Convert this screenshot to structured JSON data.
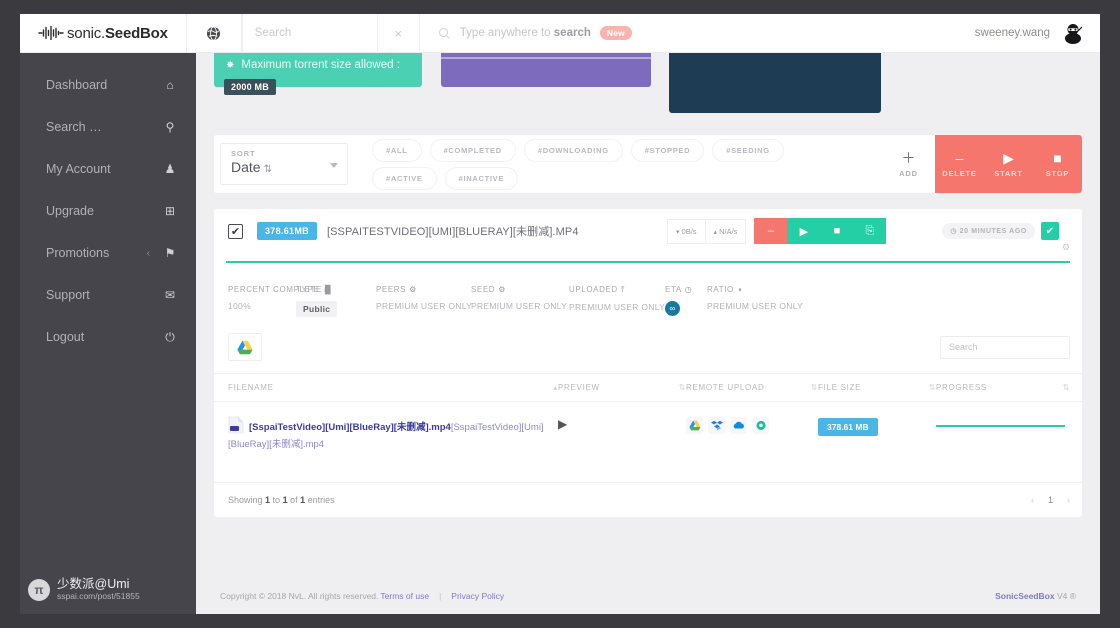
{
  "header": {
    "brand_thin": "sonic.",
    "brand_bold": "SeedBox",
    "globe_icon": "globe-icon",
    "search_placeholder": "Search",
    "search_value": "",
    "clear_icon": "×",
    "omni_icon": "search-icon",
    "omni_text_pre": "Type anywhere to ",
    "omni_text_bold": "search",
    "omni_badge": "New",
    "user_name": "sweeney.wang",
    "avatar_icon": "ninja-avatar"
  },
  "sidebar": {
    "items": [
      {
        "label": "Dashboard",
        "icon": "⌂",
        "name": "home-icon",
        "caret": ""
      },
      {
        "label": "Search …",
        "icon": "⚲",
        "name": "search-icon",
        "caret": ""
      },
      {
        "label": "My Account",
        "icon": "♟",
        "name": "user-icon",
        "caret": ""
      },
      {
        "label": "Upgrade",
        "icon": "⊞",
        "name": "plus-box-icon",
        "caret": ""
      },
      {
        "label": "Promotions",
        "icon": "⚑",
        "name": "tag-icon",
        "caret": "‹"
      },
      {
        "label": "Support",
        "icon": "✉",
        "name": "mail-icon",
        "caret": ""
      },
      {
        "label": "Logout",
        "icon": "⏻",
        "name": "power-icon",
        "caret": ""
      }
    ],
    "watermark": {
      "mark": "π",
      "title": "少数派@Umi",
      "url": "sspai.com/post/51855"
    }
  },
  "promos": {
    "a": {
      "star": "✸",
      "title": "Maximum torrent size allowed :",
      "badge": "2000 MB",
      "color": "#4bd0b4"
    },
    "b": {
      "color": "#7d6bbd"
    },
    "c": {
      "color": "#1e3d55"
    }
  },
  "sortbar": {
    "sort_caption": "SORT",
    "sort_value": "Date",
    "sort_arrows": "⇅",
    "tags": [
      "#ALL",
      "#COMPLETED",
      "#DOWNLOADING",
      "#STOPPED",
      "#SEEDING",
      "#ACTIVE",
      "#INACTIVE"
    ],
    "actions": [
      {
        "glyph": "＋",
        "label": "ADD",
        "style": "add"
      },
      {
        "glyph": "–",
        "label": "DELETE",
        "style": "red"
      },
      {
        "glyph": "▶",
        "label": "START",
        "style": "red"
      },
      {
        "glyph": "■",
        "label": "STOP",
        "style": "red"
      }
    ],
    "accent_red": "#f4766c"
  },
  "torrent": {
    "checkbox_icon": "✔",
    "size_badge": "378.61MB",
    "name": "[SspaiTestVideo][Umi][BlueRay][未删减].mp4",
    "down_arrow": "▾",
    "down_speed": "0B/s",
    "up_arrow": "▴",
    "up_speed": "N/A/s",
    "buttons": [
      {
        "glyph": "–",
        "name": "remove-torrent-button",
        "style": "minus"
      },
      {
        "glyph": "▶",
        "name": "start-torrent-button",
        "style": "play"
      },
      {
        "glyph": "■",
        "name": "stop-torrent-button",
        "style": "stop"
      },
      {
        "glyph": "⎘",
        "name": "torrent-file-button",
        "style": "file"
      }
    ],
    "ago": "◷ 20 MINUTES AGO",
    "ok_icon": "✔",
    "gear_icon": "⚙",
    "progress_percent": 100,
    "stats": [
      {
        "head": "PERCENT COMPLETE",
        "head_icon": "█",
        "value": "100%",
        "kind": "text",
        "w": "s1"
      },
      {
        "head": "TYPE",
        "head_icon": "♁",
        "value": "Public",
        "kind": "chip",
        "w": "s2"
      },
      {
        "head": "PEERS",
        "head_icon": "⚙",
        "value": "PREMIUM USER ONLY",
        "kind": "text",
        "w": "s3"
      },
      {
        "head": "SEED",
        "head_icon": "⚙",
        "value": "PREMIUM USER ONLY",
        "kind": "text",
        "w": "s4"
      },
      {
        "head": "UPLOADED",
        "head_icon": "⤒",
        "value": "PREMIUM USER ONLY",
        "kind": "text",
        "w": "s5"
      },
      {
        "head": "ETA",
        "head_icon": "◷",
        "value": "∞",
        "kind": "dot",
        "w": "s6"
      },
      {
        "head": "RATIO",
        "head_icon": "◑",
        "value": "PREMIUM USER ONLY",
        "kind": "text",
        "w": "s7"
      }
    ]
  },
  "filetable": {
    "drive_icon": "google-drive-icon",
    "search_placeholder": "Search",
    "search_value": "",
    "columns": [
      {
        "label": "FILENAME",
        "sort": "▴"
      },
      {
        "label": "PREVIEW",
        "sort": "⇅"
      },
      {
        "label": "REMOTE UPLOAD",
        "sort": "⇅"
      },
      {
        "label": "FILE SIZE",
        "sort": "⇅"
      },
      {
        "label": "PROGRESS",
        "sort": "⇅"
      }
    ],
    "row": {
      "file_ext_label": "MP4",
      "name_strong": "[SspaiTestVideo][Umi][BlueRay][未删减].mp4",
      "name_faint": "[SspaiTestVideo][Umi][BlueRay][未删减].mp4",
      "preview_icon": "▶",
      "clouds": [
        {
          "name": "google-drive-icon",
          "glyph": "△",
          "color": "#4caf50"
        },
        {
          "name": "dropbox-icon",
          "glyph": "❖",
          "color": "#1e7ee8"
        },
        {
          "name": "onedrive-icon",
          "glyph": "☁",
          "color": "#0f8ddb"
        },
        {
          "name": "mega-icon",
          "glyph": "◉",
          "color": "#16bfa0"
        }
      ],
      "file_size": "378.61 MB",
      "progress_percent": 100
    },
    "showing_pre": "Showing ",
    "showing_from": "1",
    "showing_mid": " to ",
    "showing_to": "1",
    "showing_mid2": " of ",
    "showing_total": "1",
    "showing_post": " entries",
    "pager_prev": "‹",
    "pager_page": "1",
    "pager_next": "›"
  },
  "footer": {
    "copyright": "Copyright © 2018 NvL. All rights reserved.",
    "terms": "Terms of use",
    "separator": "|",
    "privacy": "Privacy Policy",
    "product": "SonicSeedBox",
    "version": " V4 ®"
  }
}
